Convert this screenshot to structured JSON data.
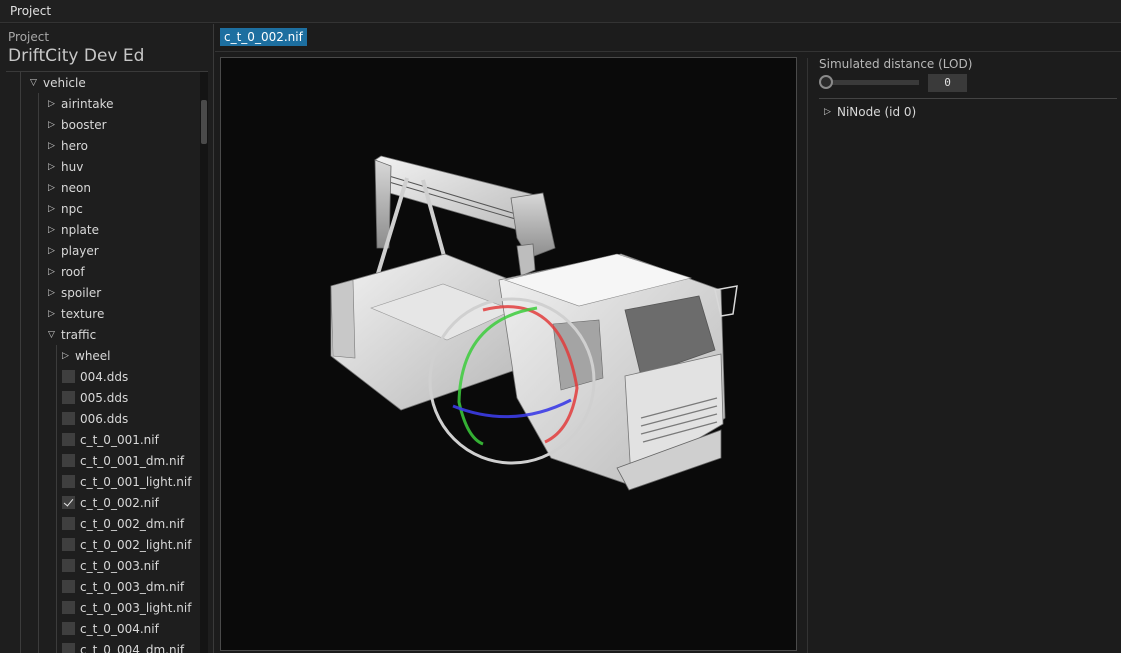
{
  "menubar": {
    "project": "Project"
  },
  "left": {
    "label": "Project",
    "name": "DriftCity Dev Ed",
    "tree": [
      {
        "label": "vehicle",
        "depth": 0,
        "kind": "expanded"
      },
      {
        "label": "airintake",
        "depth": 1,
        "kind": "collapsed"
      },
      {
        "label": "booster",
        "depth": 1,
        "kind": "collapsed"
      },
      {
        "label": "hero",
        "depth": 1,
        "kind": "collapsed"
      },
      {
        "label": "huv",
        "depth": 1,
        "kind": "collapsed"
      },
      {
        "label": "neon",
        "depth": 1,
        "kind": "collapsed"
      },
      {
        "label": "npc",
        "depth": 1,
        "kind": "collapsed"
      },
      {
        "label": "nplate",
        "depth": 1,
        "kind": "collapsed"
      },
      {
        "label": "player",
        "depth": 1,
        "kind": "collapsed"
      },
      {
        "label": "roof",
        "depth": 1,
        "kind": "collapsed"
      },
      {
        "label": "spoiler",
        "depth": 1,
        "kind": "collapsed"
      },
      {
        "label": "texture",
        "depth": 1,
        "kind": "collapsed"
      },
      {
        "label": "traffic",
        "depth": 1,
        "kind": "expanded"
      },
      {
        "label": "wheel",
        "depth": 2,
        "kind": "collapsed"
      },
      {
        "label": "004.dds",
        "depth": 2,
        "kind": "file",
        "checked": false
      },
      {
        "label": "005.dds",
        "depth": 2,
        "kind": "file",
        "checked": false
      },
      {
        "label": "006.dds",
        "depth": 2,
        "kind": "file",
        "checked": false
      },
      {
        "label": "c_t_0_001.nif",
        "depth": 2,
        "kind": "file",
        "checked": false
      },
      {
        "label": "c_t_0_001_dm.nif",
        "depth": 2,
        "kind": "file",
        "checked": false
      },
      {
        "label": "c_t_0_001_light.nif",
        "depth": 2,
        "kind": "file",
        "checked": false
      },
      {
        "label": "c_t_0_002.nif",
        "depth": 2,
        "kind": "file",
        "checked": true
      },
      {
        "label": "c_t_0_002_dm.nif",
        "depth": 2,
        "kind": "file",
        "checked": false
      },
      {
        "label": "c_t_0_002_light.nif",
        "depth": 2,
        "kind": "file",
        "checked": false
      },
      {
        "label": "c_t_0_003.nif",
        "depth": 2,
        "kind": "file",
        "checked": false
      },
      {
        "label": "c_t_0_003_dm.nif",
        "depth": 2,
        "kind": "file",
        "checked": false
      },
      {
        "label": "c_t_0_003_light.nif",
        "depth": 2,
        "kind": "file",
        "checked": false
      },
      {
        "label": "c_t_0_004.nif",
        "depth": 2,
        "kind": "file",
        "checked": false
      },
      {
        "label": "c_t_0_004_dm.nif",
        "depth": 2,
        "kind": "file",
        "checked": false
      }
    ]
  },
  "tabs": [
    {
      "label": "c_t_0_002.nif",
      "active": true
    }
  ],
  "right": {
    "lod_label": "Simulated distance (LOD)",
    "lod_value": "0",
    "lod_fraction": 0,
    "node": "NiNode (id 0)"
  },
  "icons": {
    "expanded": "▽",
    "collapsed": "▷",
    "checkbox": "checkbox-icon"
  },
  "colors": {
    "accent": "#1d6fa0",
    "gizmo_x": "#e23c3c",
    "gizmo_y": "#3ccc3c",
    "gizmo_z": "#3c3ce6"
  }
}
